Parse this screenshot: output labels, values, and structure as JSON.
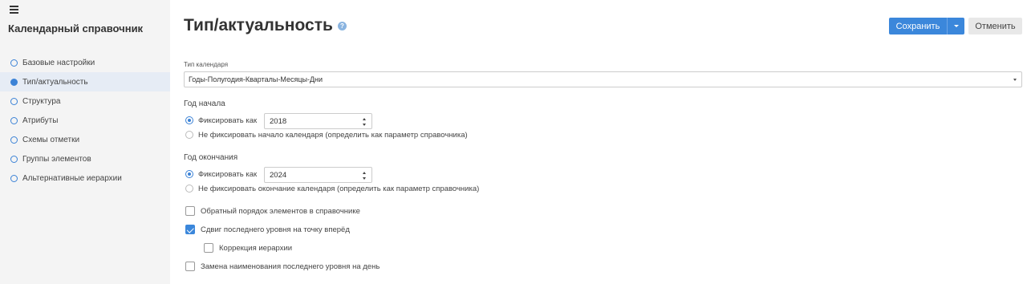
{
  "sidebar": {
    "title": "Календарный справочник",
    "items": [
      {
        "label": "Базовые настройки",
        "active": false
      },
      {
        "label": "Тип/актуальность",
        "active": true
      },
      {
        "label": "Структура",
        "active": false
      },
      {
        "label": "Атрибуты",
        "active": false
      },
      {
        "label": "Схемы отметки",
        "active": false
      },
      {
        "label": "Группы элементов",
        "active": false
      },
      {
        "label": "Альтернативные иерархии",
        "active": false
      }
    ]
  },
  "header": {
    "title": "Тип/актуальность",
    "help_icon": "?",
    "save_label": "Сохранить",
    "cancel_label": "Отменить"
  },
  "form": {
    "calendar_type": {
      "label": "Тип календаря",
      "value": "Годы-Полугодия-Кварталы-Месяцы-Дни"
    },
    "start_year": {
      "label": "Год начала",
      "fix_label": "Фиксировать как",
      "fix_value": "2018",
      "nofix_label": "Не фиксировать начало календаря (определить как параметр справочника)",
      "selected": "fix"
    },
    "end_year": {
      "label": "Год окончания",
      "fix_label": "Фиксировать как",
      "fix_value": "2024",
      "nofix_label": "Не фиксировать окончание календаря (определить как параметр справочника)",
      "selected": "fix"
    },
    "options": {
      "reverse_order": {
        "label": "Обратный порядок элементов в справочнике",
        "checked": false
      },
      "shift_last_level": {
        "label": "Сдвиг последнего уровня на точку вперёд",
        "checked": true
      },
      "hierarchy_correction": {
        "label": "Коррекция иерархии",
        "checked": false
      },
      "rename_last_level": {
        "label": "Замена наименования последнего уровня на день",
        "checked": false
      }
    }
  },
  "colors": {
    "accent": "#3b87db",
    "sidebar_bg": "#f4f4f4",
    "active_item_bg": "#e6ecf5"
  },
  "icons": {
    "menu": "hamburger-icon",
    "help": "question-circle-icon",
    "dropdown": "caret-down-icon",
    "stepper": "up-down-arrows-icon"
  }
}
